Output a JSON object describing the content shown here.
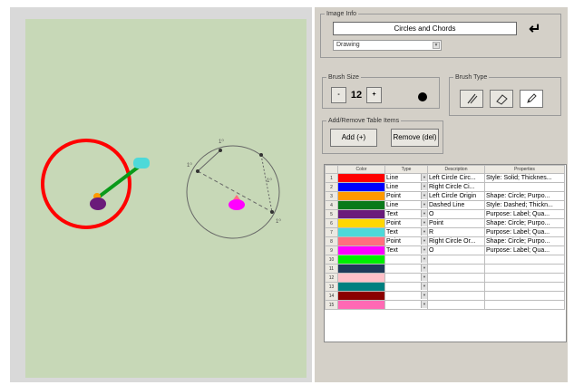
{
  "image_info": {
    "legend": "Image Info",
    "title_value": "Circles and Chords",
    "enter_icon": "↵",
    "category_value": "Drawing"
  },
  "brush_size": {
    "legend": "Brush Size",
    "minus": "-",
    "value": "12",
    "plus": "+"
  },
  "brush_type": {
    "legend": "Brush Type",
    "tools": [
      "brush-icon",
      "eraser-icon",
      "pencil-icon"
    ]
  },
  "table_items": {
    "legend": "Add/Remove Table Items",
    "add_label": "Add (+)",
    "remove_label": "Remove (del)"
  },
  "table": {
    "headers": [
      "",
      "Color",
      "Type",
      "Description",
      "Properties"
    ],
    "rows": [
      {
        "n": "1",
        "color": "#ff0000",
        "type": "Line",
        "desc": "Left Circle Circ...",
        "props": "Style: Solid; Thicknes..."
      },
      {
        "n": "2",
        "color": "#0000ff",
        "type": "Line",
        "desc": "Right Circle Ci...",
        "props": ""
      },
      {
        "n": "3",
        "color": "#ff9900",
        "type": "Point",
        "desc": "Left Circle Origin",
        "props": "Shape: Circle; Purpo..."
      },
      {
        "n": "4",
        "color": "#0a7a1a",
        "type": "Line",
        "desc": "Dashed Line",
        "props": "Style: Dashed; Thickn..."
      },
      {
        "n": "5",
        "color": "#6a1b7a",
        "type": "Text",
        "desc": "O",
        "props": "Purpose: Label; Qua..."
      },
      {
        "n": "6",
        "color": "#ffd700",
        "type": "Point",
        "desc": "Point",
        "props": "Shape: Circle; Purpo..."
      },
      {
        "n": "7",
        "color": "#4dd9d9",
        "type": "Text",
        "desc": "R",
        "props": "Purpose: Label; Qua..."
      },
      {
        "n": "8",
        "color": "#ff6f7f",
        "type": "Point",
        "desc": "Right Circle Or...",
        "props": "Shape: Circle; Purpo..."
      },
      {
        "n": "9",
        "color": "#ff00ff",
        "type": "Text",
        "desc": "O",
        "props": "Purpose: Label; Qua..."
      },
      {
        "n": "10",
        "color": "#00ee00",
        "type": "",
        "desc": "",
        "props": ""
      },
      {
        "n": "11",
        "color": "#1f3a5a",
        "type": "",
        "desc": "",
        "props": ""
      },
      {
        "n": "12",
        "color": "#ffc0c8",
        "type": "",
        "desc": "",
        "props": ""
      },
      {
        "n": "13",
        "color": "#008080",
        "type": "",
        "desc": "",
        "props": ""
      },
      {
        "n": "14",
        "color": "#8b0000",
        "type": "",
        "desc": "",
        "props": ""
      },
      {
        "n": "15",
        "color": "#ff69b4",
        "type": "",
        "desc": "",
        "props": ""
      }
    ]
  },
  "canvas": {
    "right_circle_labels": [
      "1⁰",
      "1⁰",
      "1⁰",
      "1⁰"
    ]
  }
}
